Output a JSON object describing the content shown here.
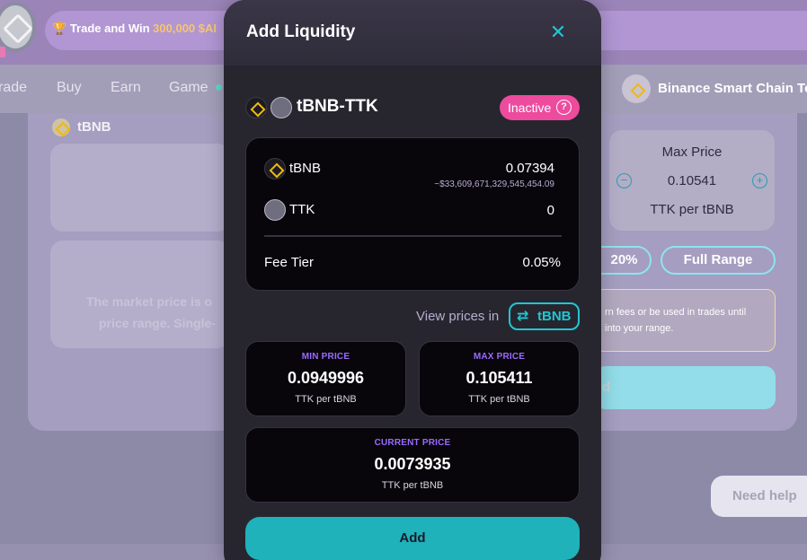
{
  "banner": {
    "text_prefix": "Trade and Win ",
    "text_highlight": "300,000 $AI"
  },
  "nav": {
    "items": [
      "rade",
      "Buy",
      "Earn",
      "Game"
    ],
    "chain": "Binance Smart Chain Te"
  },
  "background": {
    "token_label": "tBNB",
    "market_text_line1": "The market price is o",
    "market_text_line2": "price range. Single-",
    "max_price_label": "Max Price",
    "max_price_value": "0.10541",
    "max_price_unit": "TTK per tBNB",
    "minus": "−",
    "plus": "+",
    "range_20": "20%",
    "range_full": "Full Range",
    "warning_line1": "rn fees or be used in trades until",
    "warning_line2": "into your range.",
    "add_partial": "d",
    "help": "Need help"
  },
  "modal": {
    "title": "Add Liquidity",
    "close": "✕",
    "pair": "tBNB-TTK",
    "status_badge": "Inactive",
    "status_help": "?",
    "tokens": [
      {
        "name": "tBNB",
        "amount": "0.07394",
        "usd": "~$33,609,671,329,545,454.09"
      },
      {
        "name": "TTK",
        "amount": "0"
      }
    ],
    "fee_tier_label": "Fee Tier",
    "fee_tier_value": "0.05%",
    "view_prices_label": "View prices in",
    "view_prices_token": "tBNB",
    "swap_icon": "⇄",
    "min_price": {
      "label": "MIN PRICE",
      "value": "0.0949996",
      "unit": "TTK per tBNB"
    },
    "max_price": {
      "label": "MAX PRICE",
      "value": "0.105411",
      "unit": "TTK per tBNB"
    },
    "current_price": {
      "label": "CURRENT PRICE",
      "value": "0.0073935",
      "unit": "TTK per tBNB"
    },
    "add_button": "Add"
  },
  "colors": {
    "accent": "#1fc7d4",
    "badge_inactive": "#ed4b9e",
    "label_purple": "#9a6aff",
    "modal_bg": "#27262f",
    "card_bg": "#08060b"
  },
  "icons": {
    "trophy": "trophy-icon",
    "bnb": "bnb-token-icon",
    "ttk": "ttk-token-icon",
    "close": "close-icon",
    "help": "question-icon",
    "swap": "swap-icon"
  }
}
